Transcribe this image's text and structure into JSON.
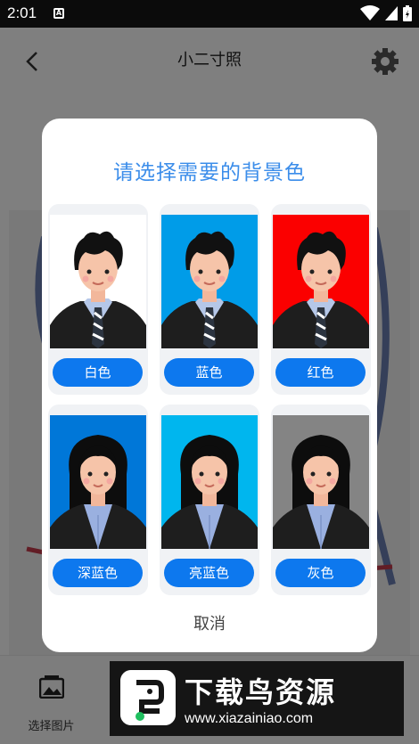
{
  "status_bar": {
    "time": "2:01",
    "notification_glyph": "A"
  },
  "app": {
    "title": "小二寸照",
    "bottom_tools": [
      {
        "label": "选择图片",
        "icon": "image-icon"
      }
    ]
  },
  "watermark": {
    "title": "下载鸟资源",
    "url": "www.xiazainiao.com"
  },
  "dialog": {
    "title": "请选择需要的背景色",
    "options": [
      {
        "label": "白色",
        "bg_color": "#ffffff",
        "gender": "male"
      },
      {
        "label": "蓝色",
        "bg_color": "#009ce8",
        "gender": "male"
      },
      {
        "label": "红色",
        "bg_color": "#fb0000",
        "gender": "male"
      },
      {
        "label": "深蓝色",
        "bg_color": "#0077d8",
        "gender": "female"
      },
      {
        "label": "亮蓝色",
        "bg_color": "#00b6ee",
        "gender": "female"
      },
      {
        "label": "灰色",
        "bg_color": "#848484",
        "gender": "female"
      }
    ],
    "cancel_label": "取消"
  },
  "colors": {
    "accent": "#0d78ee",
    "title_blue": "#3b8dea",
    "overlay": "rgba(0,0,0,0.5)"
  }
}
